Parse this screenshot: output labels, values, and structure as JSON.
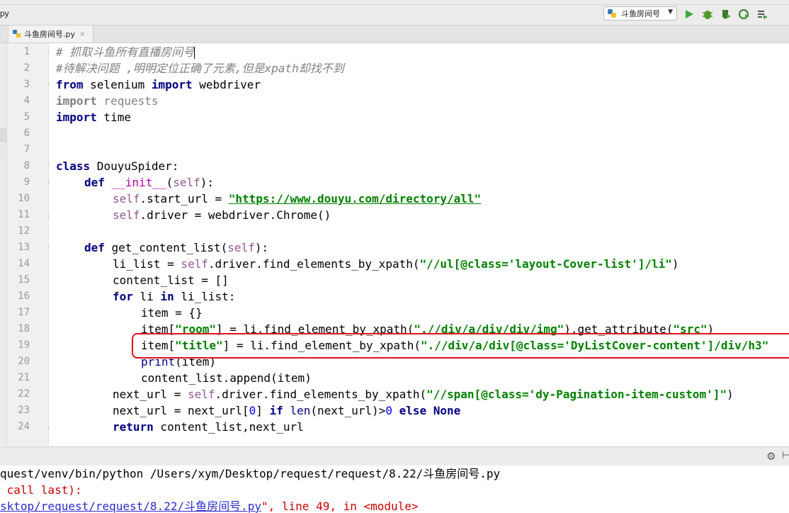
{
  "window": {
    "current_file_fragment": "py",
    "run_config": {
      "label": "斗鱼房间号"
    }
  },
  "toolbar_icons": [
    "python-run-config-icon",
    "run-icon",
    "debug-icon",
    "coverage-icon",
    "profile-icon",
    "concurrency-icon"
  ],
  "tab": {
    "label": "斗鱼房间号.py",
    "close": "×"
  },
  "editor": {
    "line_numbers": [
      "1",
      "2",
      "3",
      "4",
      "5",
      "6",
      "7",
      "8",
      "9",
      "10",
      "11",
      "12",
      "13",
      "14",
      "15",
      "16",
      "17",
      "18",
      "19",
      "20",
      "21",
      "22",
      "23",
      "24"
    ],
    "l1": "# 抓取斗鱼所有直播房间号",
    "l2": "#待解决问题 ,明明定位正确了元素,但是xpath却找不到",
    "l3_kw1": "from",
    "l3_t1": " selenium ",
    "l3_kw2": "import",
    "l3_t2": " webdriver",
    "l4_kw": "import",
    "l4_t": " requests",
    "l5_kw": "import",
    "l5_t": " time",
    "l8_kw": "class",
    "l8_t": " DouyuSpider:",
    "l9_kw": "def",
    "l9_fn": " __init__",
    "l9_p1": "(",
    "l9_self": "self",
    "l9_p2": "):",
    "l10_self": "self",
    "l10_t": ".start_url = ",
    "l10_s": "\"https://www.douyu.com/directory/all\"",
    "l11_self": "self",
    "l11_t": ".driver = webdriver.Chrome()",
    "l13_kw": "def",
    "l13_t": " get_content_list(",
    "l13_self": "self",
    "l13_t2": "):",
    "l14_t": "li_list = ",
    "l14_self": "self",
    "l14_t2": ".driver.find_elements_by_xpath(",
    "l14_s": "\"//ul[@class='layout-Cover-list']/li\"",
    "l14_t3": ")",
    "l15_t": "content_list = []",
    "l16_kw": "for",
    "l16_t": " li ",
    "l16_kw2": "in",
    "l16_t2": " li_list:",
    "l17_t": "item = {}",
    "l18_t": "item[",
    "l18_s": "\"room\"",
    "l18_t2": "] = li.find_element_by_xpath(",
    "l18_s2": "\".//div/a/div/div/img\"",
    "l18_t3": ").get_attribute(",
    "l18_s3": "\"src\"",
    "l18_t4": ")",
    "l19_t": "item[",
    "l19_s": "\"title\"",
    "l19_t2": "] = li.find_element_by_xpath(",
    "l19_s2": "\".//div/a/div[@class='DyListCover-content']/div/h3\"",
    "l20_b": "print",
    "l20_t": "(item)",
    "l21_t": "content_list.append(item)",
    "l22_t": "next_url = ",
    "l22_self": "self",
    "l22_t2": ".driver.find_elements_by_xpath(",
    "l22_s": "\"//span[@class='dy-Pagination-item-custom']\"",
    "l22_t3": ")",
    "l23_t": "next_url = next_url[",
    "l23_n": "0",
    "l23_t2": "] ",
    "l23_kw": "if",
    "l23_b": " len",
    "l23_t3": "(next_url)>",
    "l23_n2": "0",
    "l23_kw2": " else None",
    "l24_kw": "return",
    "l24_t": " content_list,next_url"
  },
  "console": {
    "line1": "quest/venv/bin/python /Users/xym/Desktop/request/request/8.22/斗鱼房间号.py",
    "line2": " call last):",
    "line3_link": "sktop/request/request/8.22/斗鱼房间号.py",
    "line3_rest": "\", line 49, in <module>"
  },
  "colors": {
    "error": "#cc0000",
    "highlight_box": "#e0101a",
    "keyword": "#000080",
    "string": "#008000",
    "self": "#94558d"
  }
}
